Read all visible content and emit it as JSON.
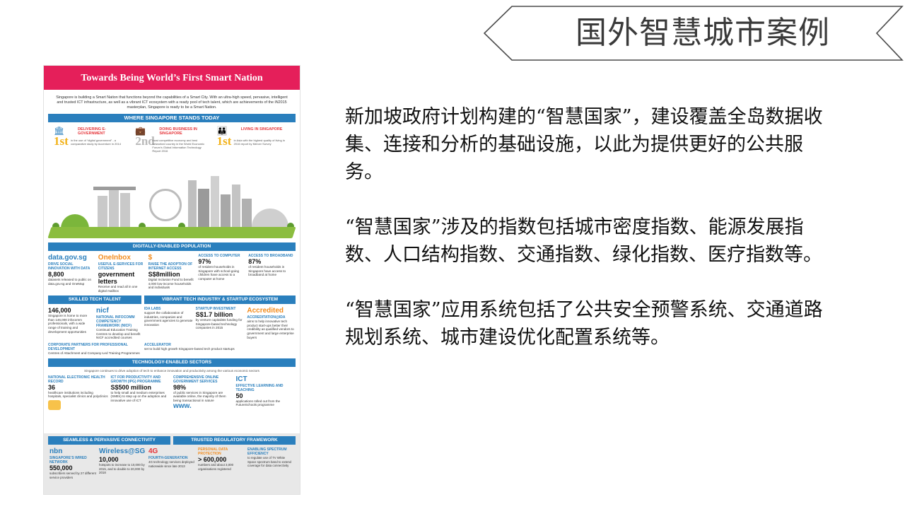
{
  "slide": {
    "title": "国外智慧城市案例",
    "paragraphs": [
      "新加坡政府计划构建的“智慧国家”，建设覆盖全岛数据收集、连接和分析的基础设施，以此为提供更好的公共服务。",
      "“智慧国家”涉及的指数包括城市密度指数、能源发展指数、人口结构指数、交通指数、绿化指数、医疗指数等。",
      "“智慧国家”应用系统包括了公共安全预警系统、交通道路规划系统、城市建设优化配置系统等。"
    ],
    "colors": {
      "title_outline": "#4a4a4a",
      "banner": "#e51f5a",
      "section": "#2a7fbd",
      "accent": "#f2b21a"
    }
  },
  "infographic": {
    "banner": "Towards Being World’s First Smart Nation",
    "intro": "Singapore is building a Smart Nation that functions beyond the capabilities of a Smart City. With an ultra-high speed, pervasive, intelligent and trusted ICT infrastructure, as well as a vibrant ICT ecosystem with a ready pool of tech talent, which are achievements of the iN2015 masterplan, Singapore is ready to be a Smart Nation.",
    "where_title": "WHERE SINGAPORE STANDS TODAY",
    "stands": [
      {
        "rank": "1st",
        "heading": "DELIVERING E-GOVERNMENT",
        "text": "in the use of “digital government” - a comparative study by Accenture in 2014"
      },
      {
        "rank": "2nd",
        "heading": "DOING BUSINESS IN SINGAPORE",
        "text": "most competitive economy and best networked country in the World Economic Forum’s Global Information Technology Report 2016"
      },
      {
        "rank": "1st",
        "heading": "LIVING IN SINGAPORE",
        "text": "in Asia with the highest quality of living in 2016 report by Mercer Survey"
      }
    ],
    "digital_title": "DIGITALLY-ENABLED POPULATION",
    "digital": [
      {
        "logo": "data.gov.sg",
        "heading": "DRIVE SOCIAL INNOVATION WITH DATA",
        "big": "8,800",
        "text": "datasets released to public on data.gov.sg and OneMap"
      },
      {
        "logo": "OneInbox",
        "heading": "USEFUL E-SERVICES FOR CITIZENS",
        "big": "government letters",
        "text": "Receive and read all in one digital mailbox"
      },
      {
        "logo": "$",
        "heading": "RAISE THE ADOPTION OF INTERNET ACCESS",
        "big": "S$8million",
        "text": "Digital Inclusion Fund to benefit 4,000 low-income households and individuals"
      },
      {
        "logo": "ACCESS TO COMPUTER",
        "heading": "ACCESS TO COMPUTER",
        "big": "97%",
        "text": "of resident households in Singapore with school-going children have access to a computer at home"
      },
      {
        "logo": "ACCESS TO BROADBAND",
        "heading": "ACCESS TO BROADBAND",
        "big": "87%",
        "text": "of resident households in Singapore have access to broadband at home"
      }
    ],
    "skilled_title": "SKILLED TECH TALENT",
    "vibrant_title": "VIBRANT TECH INDUSTRY & STARTUP ECOSYSTEM",
    "skilled": [
      {
        "big": "146,000",
        "text": "Singapore is home to more than 146,000 infocomm professionals, with a wide range of training and development opportunities"
      },
      {
        "logo": "nicf",
        "heading": "NATIONAL INFOCOMM COMPETENCY FRAMEWORK (NICF)",
        "text": "Continual Education Training Centres to develop and benefit NICF accredited courses"
      },
      {
        "heading": "CORPORATE PARTNERS FOR PROFESSIONAL DEVELOPMENT",
        "text": "Centres of Attachment and Company-Led Training Programmes"
      }
    ],
    "vibrant": [
      {
        "heading": "IDA LABS",
        "text": "support the collaboration of industries, companies and government agencies to generate innovation"
      },
      {
        "heading": "ACCELERATOR",
        "text": "set to build high growth Singapore-based tech product startups"
      },
      {
        "heading": "STARTUP INVESTMENT",
        "big": "S$1.7 billion",
        "text": "by venture capitalists funding for Singapore-based technology companies in 2015"
      },
      {
        "heading": "ACCREDITATION@IDA",
        "text": "aims to help innovative tech product start-ups better their credibility as qualified vendors to government and large enterprise buyers",
        "badge": "Accredited"
      }
    ],
    "tech_title": "TECHNOLOGY-ENABLED SECTORS",
    "tech_sub": "Singapore continues to drive adoption of tech to enhance innovation and productivity among the various economic sectors",
    "tech": [
      {
        "heading": "NATIONAL ELECTRONIC HEALTH RECORD",
        "big": "36",
        "text": "healthcare institutions including hospitals, specialist clinics and polyclinics"
      },
      {
        "heading": "ICT FOR PRODUCTIVITY AND GROWTH (IPG) PROGRAMME",
        "big": "S$500 million",
        "text": "to help small and medium enterprises (SMEs) to step up on the adoption and innovative use of ICT"
      },
      {
        "heading": "COMPREHENSIVE ONLINE GOVERNMENT SERVICES",
        "big": "98%",
        "text": "of public services in Singapore are available online, the majority of them being transactional in nature",
        "badge": "www."
      },
      {
        "heading": "EFFECTIVE LEARNING AND TEACHING",
        "big": "50",
        "text": "applications rolled out from the FutureSchools programme",
        "badge": "ICT"
      }
    ],
    "seamless_title": "SEAMLESS & PERVASIVE CONNECTIVITY",
    "trusted_title": "TRUSTED REGULATORY FRAMEWORK",
    "foot": [
      {
        "logo": "nbn",
        "heading": "SINGAPORE’S WIRED NETWORK",
        "big": "550,000",
        "text": "subscribers served by 27 different service providers"
      },
      {
        "logo": "Wireless@SG",
        "big": "10,000",
        "text": "hotspots to increase to 10,000 by 2015, and to double to 20,000 by 2018"
      },
      {
        "logo": "4G",
        "heading": "FOURTH-GENERATION",
        "text": "4G technology services deployed nationwide since late 2013"
      },
      {
        "heading": "PERSONAL DATA PROTECTION",
        "big": "> 600,000",
        "text": "numbers and about 3,000 organisations registered"
      },
      {
        "heading": "ENABLING SPECTRUM EFFICIENCY",
        "text": "to regulate use of TV White Space spectrum band to extend coverage for data connectivity"
      }
    ]
  }
}
